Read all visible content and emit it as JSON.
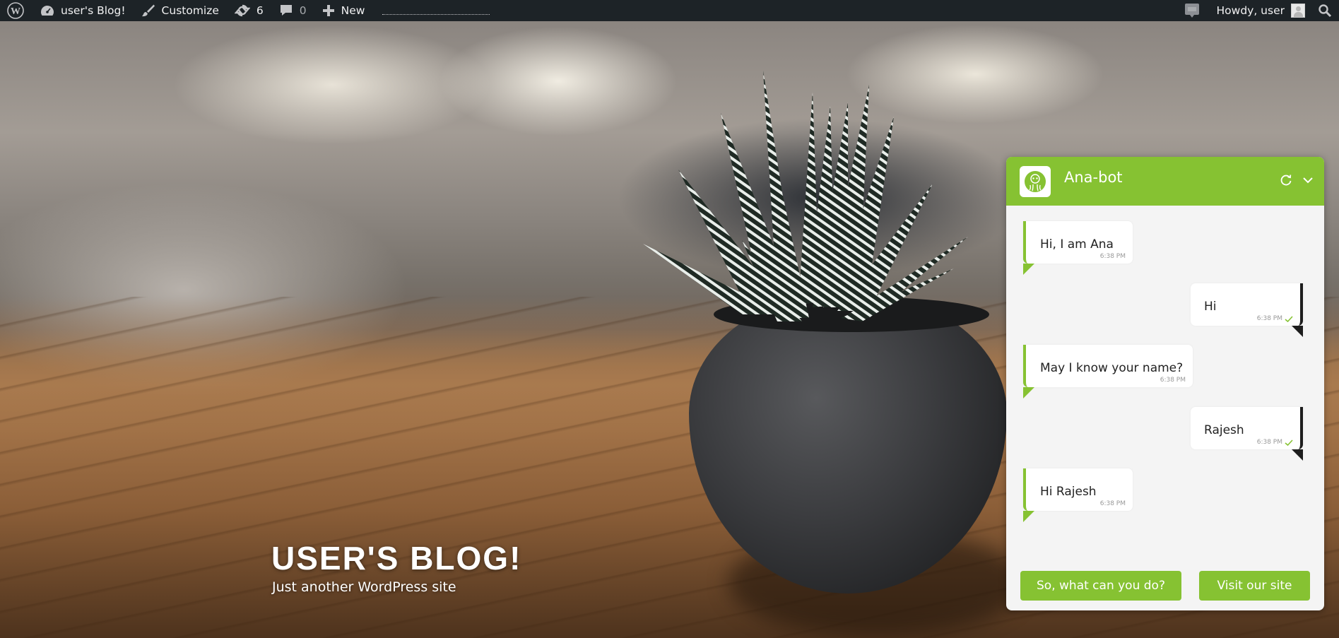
{
  "adminbar": {
    "site_name": "user's Blog!",
    "customize_label": "Customize",
    "updates_count": "6",
    "comments_count": "0",
    "new_label": "New",
    "howdy_label": "Howdy, user"
  },
  "site": {
    "title": "USER'S BLOG!",
    "description": "Just another WordPress site"
  },
  "chat": {
    "bot_name": "Ana-bot",
    "accent_color": "#86c232",
    "messages": [
      {
        "from": "bot",
        "text": "Hi, I am Ana",
        "time": "6:38 PM"
      },
      {
        "from": "user",
        "text": "Hi",
        "time": "6:38 PM"
      },
      {
        "from": "bot",
        "text": "May I know your name?",
        "time": "6:38 PM"
      },
      {
        "from": "user",
        "text": "Rajesh",
        "time": "6:38 PM"
      },
      {
        "from": "bot",
        "text": "Hi Rajesh",
        "time": "6:38 PM"
      }
    ],
    "quick_replies": [
      "So, what can you do?",
      "Visit our site"
    ]
  }
}
